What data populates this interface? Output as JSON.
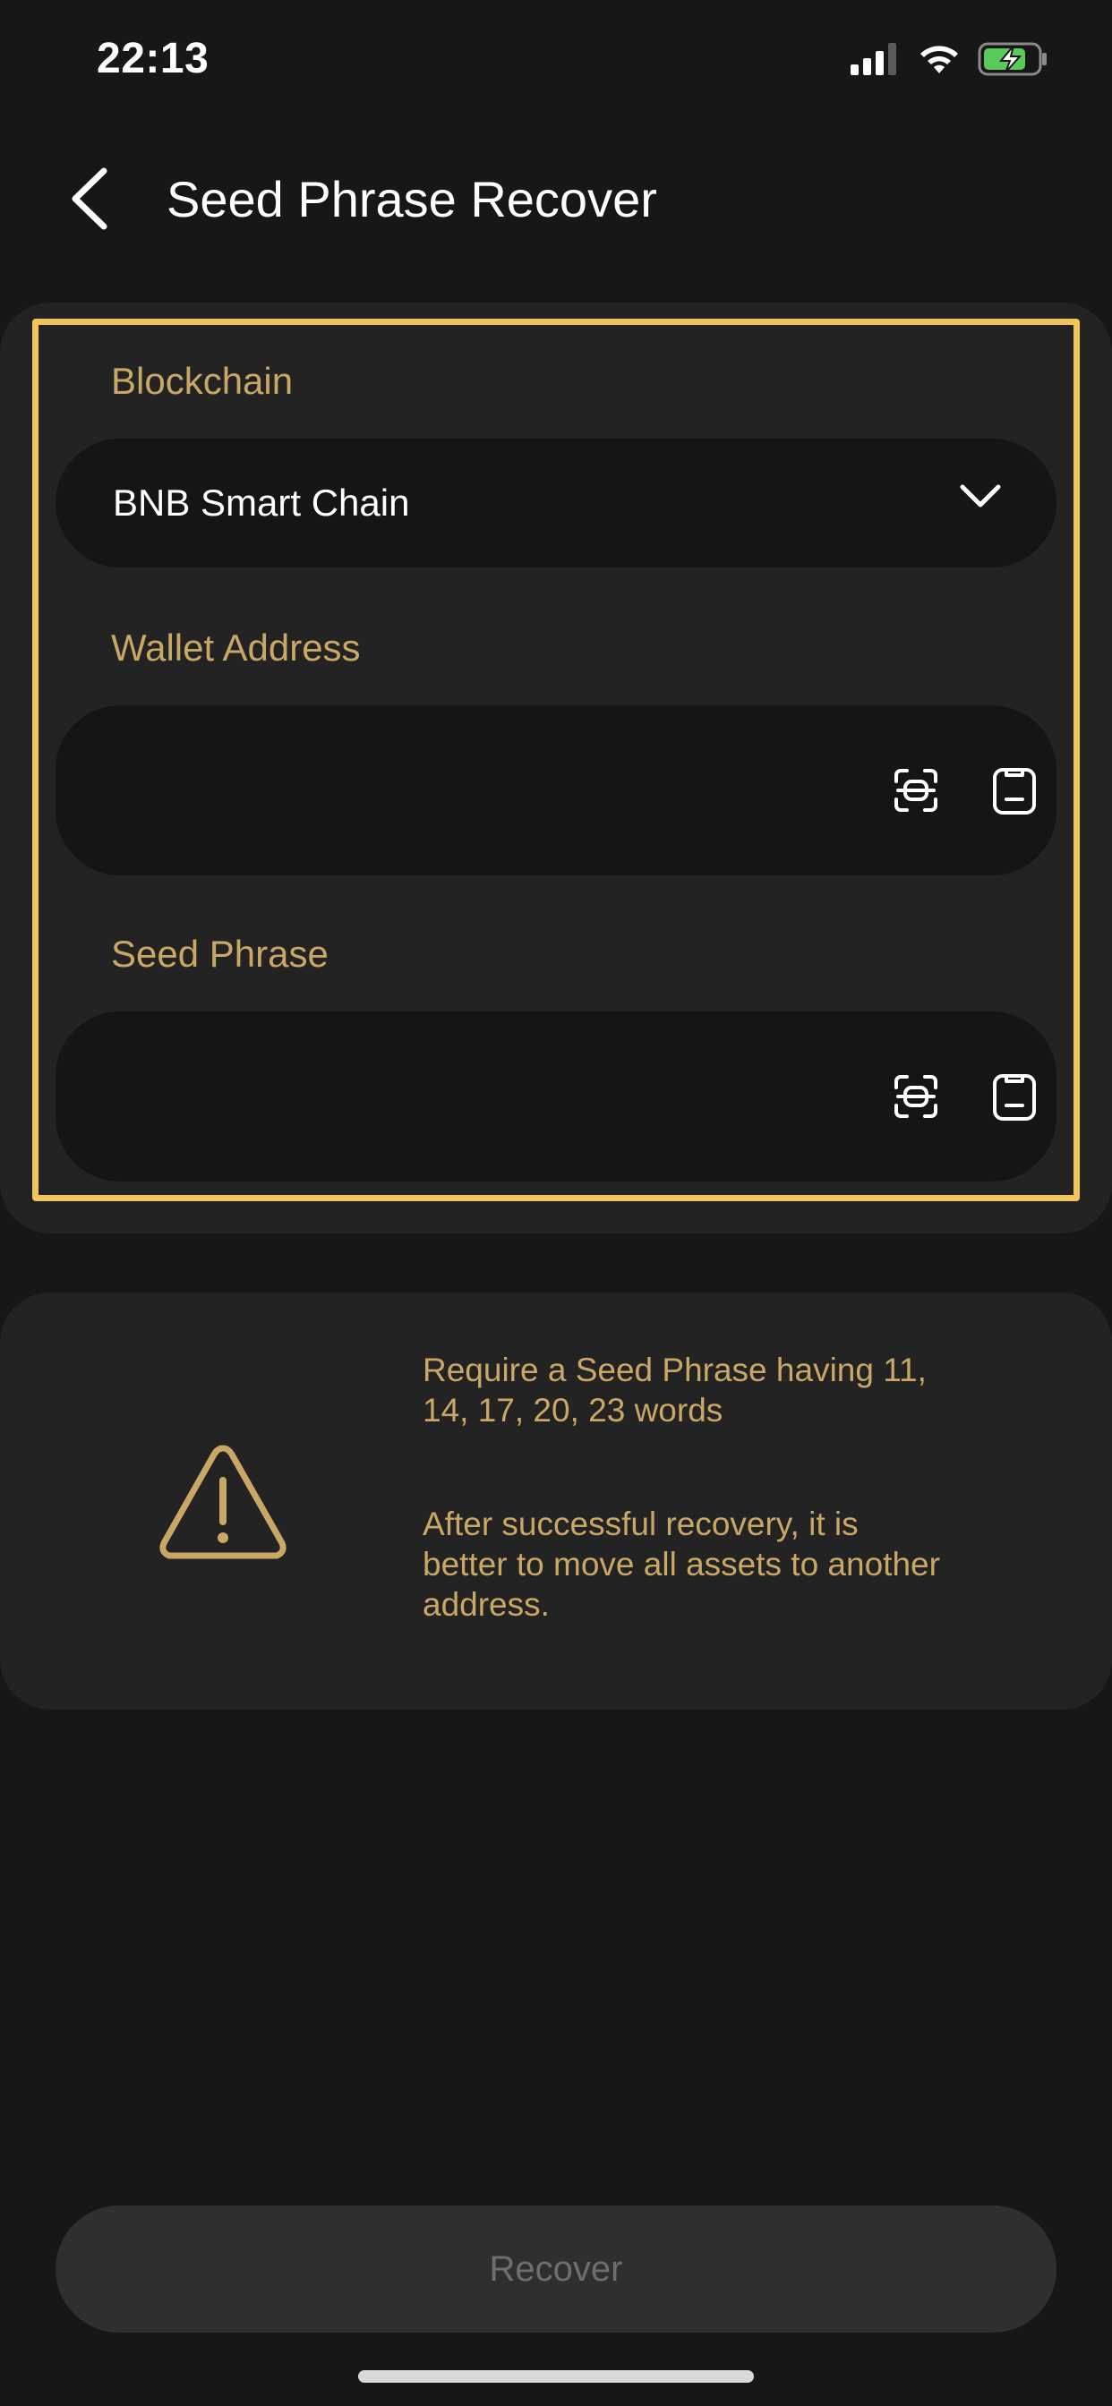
{
  "status_bar": {
    "time": "22:13",
    "signal_icon": "cellular-signal-icon",
    "wifi_icon": "wifi-icon",
    "battery_icon": "battery-charging-icon"
  },
  "header": {
    "back_icon": "chevron-left-icon",
    "title": "Seed Phrase Recover"
  },
  "form": {
    "blockchain_label": "Blockchain",
    "blockchain_value": "BNB Smart Chain",
    "dropdown_icon": "chevron-down-icon",
    "wallet_label": "Wallet Address",
    "wallet_value": "",
    "seed_label": "Seed Phrase",
    "seed_value": "",
    "scan_icon": "scan-qr-icon",
    "paste_icon": "clipboard-paste-icon"
  },
  "warning": {
    "icon": "warning-triangle-icon",
    "line1": "Require a Seed Phrase having 11, 14, 17, 20, 23 words",
    "line2": "After successful recovery, it is better to move all assets to another address."
  },
  "actions": {
    "recover_label": "Recover"
  },
  "colors": {
    "background": "#171717",
    "card": "#232323",
    "field": "#151515",
    "accent_gold": "#C9A866",
    "highlight": "#F2C55C",
    "button_disabled": "#2F2F2F",
    "button_text_disabled": "#6E6E6E"
  }
}
